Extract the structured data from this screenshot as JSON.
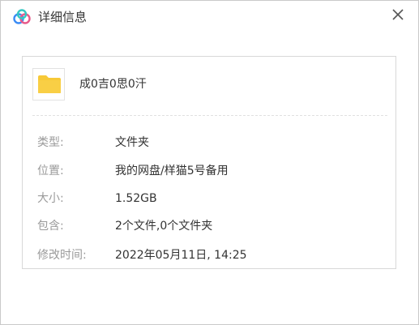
{
  "window": {
    "title": "详细信息",
    "close_glyph": "×",
    "logo_icon": "cloud-logo-icon"
  },
  "file": {
    "name": "成0吉0思0汗",
    "icon": "folder-icon",
    "icon_color": "#f7c937"
  },
  "details": [
    {
      "label": "类型:",
      "value": "文件夹"
    },
    {
      "label": "位置:",
      "value": "我的网盘/样猫5号备用"
    },
    {
      "label": "大小:",
      "value": "1.52GB"
    },
    {
      "label": "包含:",
      "value": "2个文件,0个文件夹"
    },
    {
      "label": "修改时间:",
      "value": "2022年05月11日, 14:25"
    }
  ],
  "colors": {
    "label": "#9a9a9a",
    "value": "#333333",
    "logo_blue": "#3b8cf5",
    "logo_pink": "#e85a8a",
    "logo_teal": "#35c7c2"
  }
}
